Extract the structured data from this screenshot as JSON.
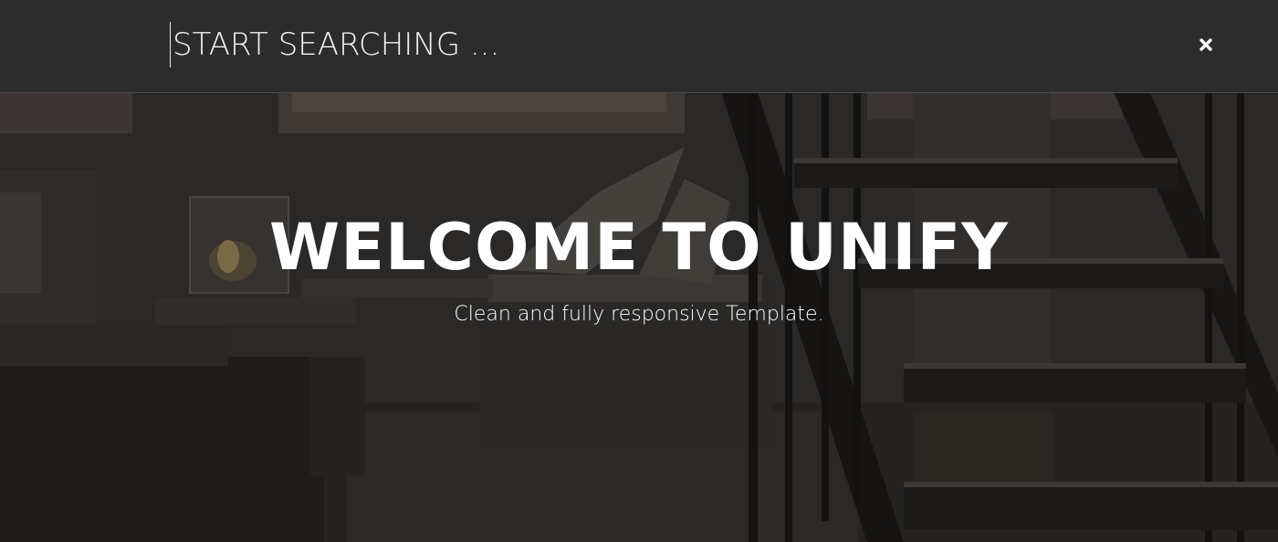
{
  "search": {
    "placeholder": "START SEARCHING ..."
  },
  "icons": {
    "close": "close-icon"
  },
  "hero": {
    "title": "WELCOME TO UNIFY",
    "subtitle": "Clean and fully responsive Template."
  },
  "colors": {
    "search_bar_bg": "#2c2c2c",
    "text": "#ffffff"
  }
}
